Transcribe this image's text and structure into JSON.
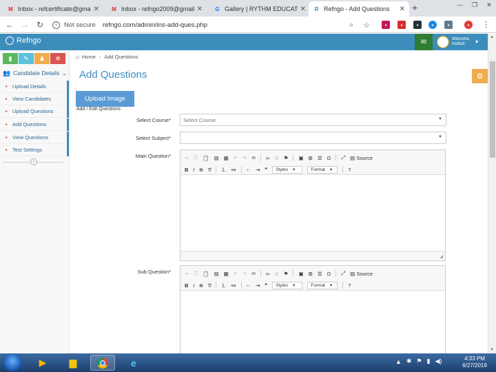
{
  "browser": {
    "tabs": [
      {
        "label": "Inbox - refcertificate@gmai",
        "favicon": "M",
        "active": false
      },
      {
        "label": "Inbox - refngo2009@gmail",
        "favicon": "M",
        "active": false
      },
      {
        "label": "Gallery | RYTHM EDUCATIO",
        "favicon": "G",
        "active": false
      },
      {
        "label": "Refngo - Add Questions",
        "favicon": "R",
        "active": true
      }
    ],
    "new_tab": "+",
    "security": "Not secure",
    "url": "refngo.com/admin/ins-add-ques.php"
  },
  "header": {
    "brand": "Refngo",
    "welcome": "Welcome,",
    "user": "instituti"
  },
  "sidebar": {
    "section": "Candidate Details",
    "items": [
      {
        "label": "Upload Details"
      },
      {
        "label": "View Candidates"
      },
      {
        "label": "Upload Questions"
      },
      {
        "label": "Add Questions"
      },
      {
        "label": "View Questions"
      },
      {
        "label": "Test Settings"
      }
    ]
  },
  "breadcrumb": {
    "home": "Home",
    "current": "Add Questions"
  },
  "main": {
    "title": "Add Questions",
    "upload_button": "Upload Image",
    "subheading": "Add / Edit Questions",
    "fields": {
      "course_label": "Select Course*",
      "course_value": "Select Course",
      "subject_label": "Select Subject*",
      "subject_value": "",
      "main_q_label": "Main Question*",
      "sub_q_label": "Sub Question*"
    },
    "editor": {
      "source": "Source",
      "styles": "Styles",
      "format": "Format"
    }
  },
  "taskbar": {
    "time": "4:33 PM",
    "date": "6/27/2019"
  },
  "colors": {
    "primary": "#3c8dbc",
    "sidebar_btn_1": "#5cb85c",
    "sidebar_btn_2": "#5bc0de",
    "sidebar_btn_3": "#f0ad4e",
    "sidebar_btn_4": "#d9534f"
  }
}
